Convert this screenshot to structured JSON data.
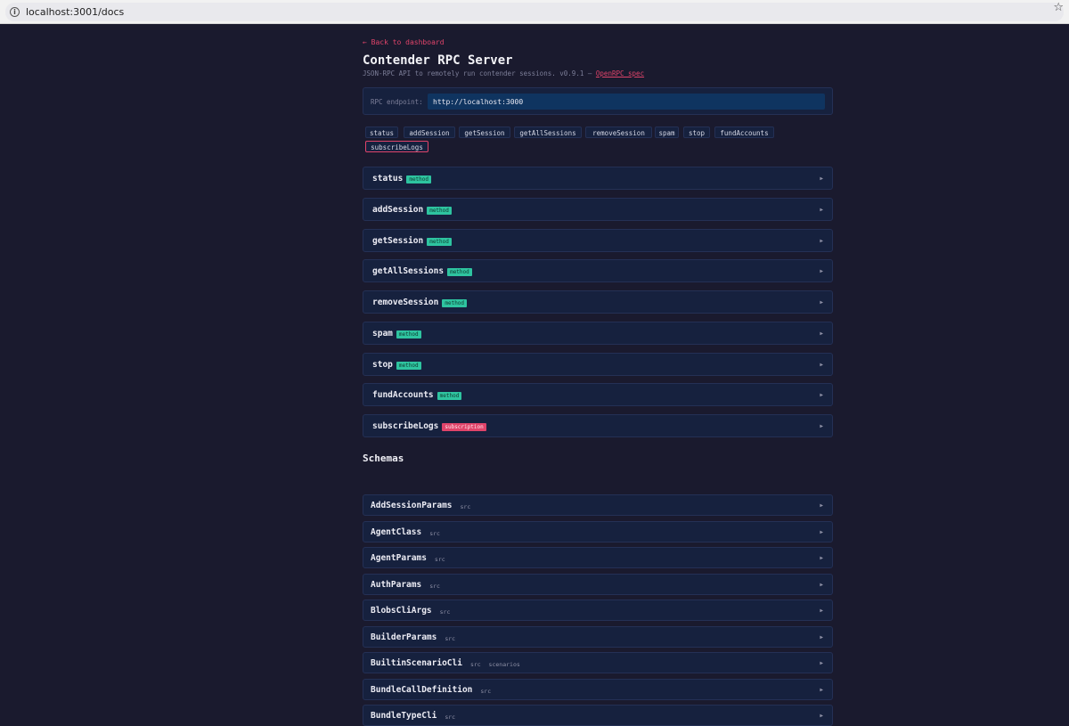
{
  "browser": {
    "url": "localhost:3001/docs"
  },
  "back_link": "← Back to dashboard",
  "title": "Contender RPC Server",
  "subtitle": {
    "text": "JSON-RPC API to remotely run contender sessions. v0.9.1 — ",
    "spec_link": "OpenRPC spec"
  },
  "endpoint": {
    "label": "RPC endpoint:",
    "value": "http://localhost:3000"
  },
  "chips": [
    "status",
    "addSession",
    "getSession",
    "getAllSessions",
    "removeSession",
    "spam",
    "stop",
    "fundAccounts",
    "subscribeLogs"
  ],
  "methods": [
    {
      "name": "status",
      "badge": "method"
    },
    {
      "name": "addSession",
      "badge": "method"
    },
    {
      "name": "getSession",
      "badge": "method"
    },
    {
      "name": "getAllSessions",
      "badge": "method"
    },
    {
      "name": "removeSession",
      "badge": "method"
    },
    {
      "name": "spam",
      "badge": "method"
    },
    {
      "name": "stop",
      "badge": "method"
    },
    {
      "name": "fundAccounts",
      "badge": "method"
    },
    {
      "name": "subscribeLogs",
      "badge": "subscription"
    }
  ],
  "schemas_heading": "Schemas",
  "schemas": [
    {
      "name": "AddSessionParams",
      "tags": [
        "src"
      ]
    },
    {
      "name": "AgentClass",
      "tags": [
        "src"
      ]
    },
    {
      "name": "AgentParams",
      "tags": [
        "src"
      ]
    },
    {
      "name": "AuthParams",
      "tags": [
        "src"
      ]
    },
    {
      "name": "BlobsCliArgs",
      "tags": [
        "src"
      ]
    },
    {
      "name": "BuilderParams",
      "tags": [
        "src"
      ]
    },
    {
      "name": "BuiltinScenarioCli",
      "tags": [
        "src",
        "scenarios"
      ]
    },
    {
      "name": "BundleCallDefinition",
      "tags": [
        "src"
      ]
    },
    {
      "name": "BundleTypeCli",
      "tags": [
        "src"
      ]
    }
  ],
  "expand_glyph": "▶",
  "colors": {
    "background": "#1a1a2e",
    "panel": "#16213e",
    "input": "#0f3460",
    "accent": "#e0446a",
    "method_badge": "#2ec4a0"
  }
}
